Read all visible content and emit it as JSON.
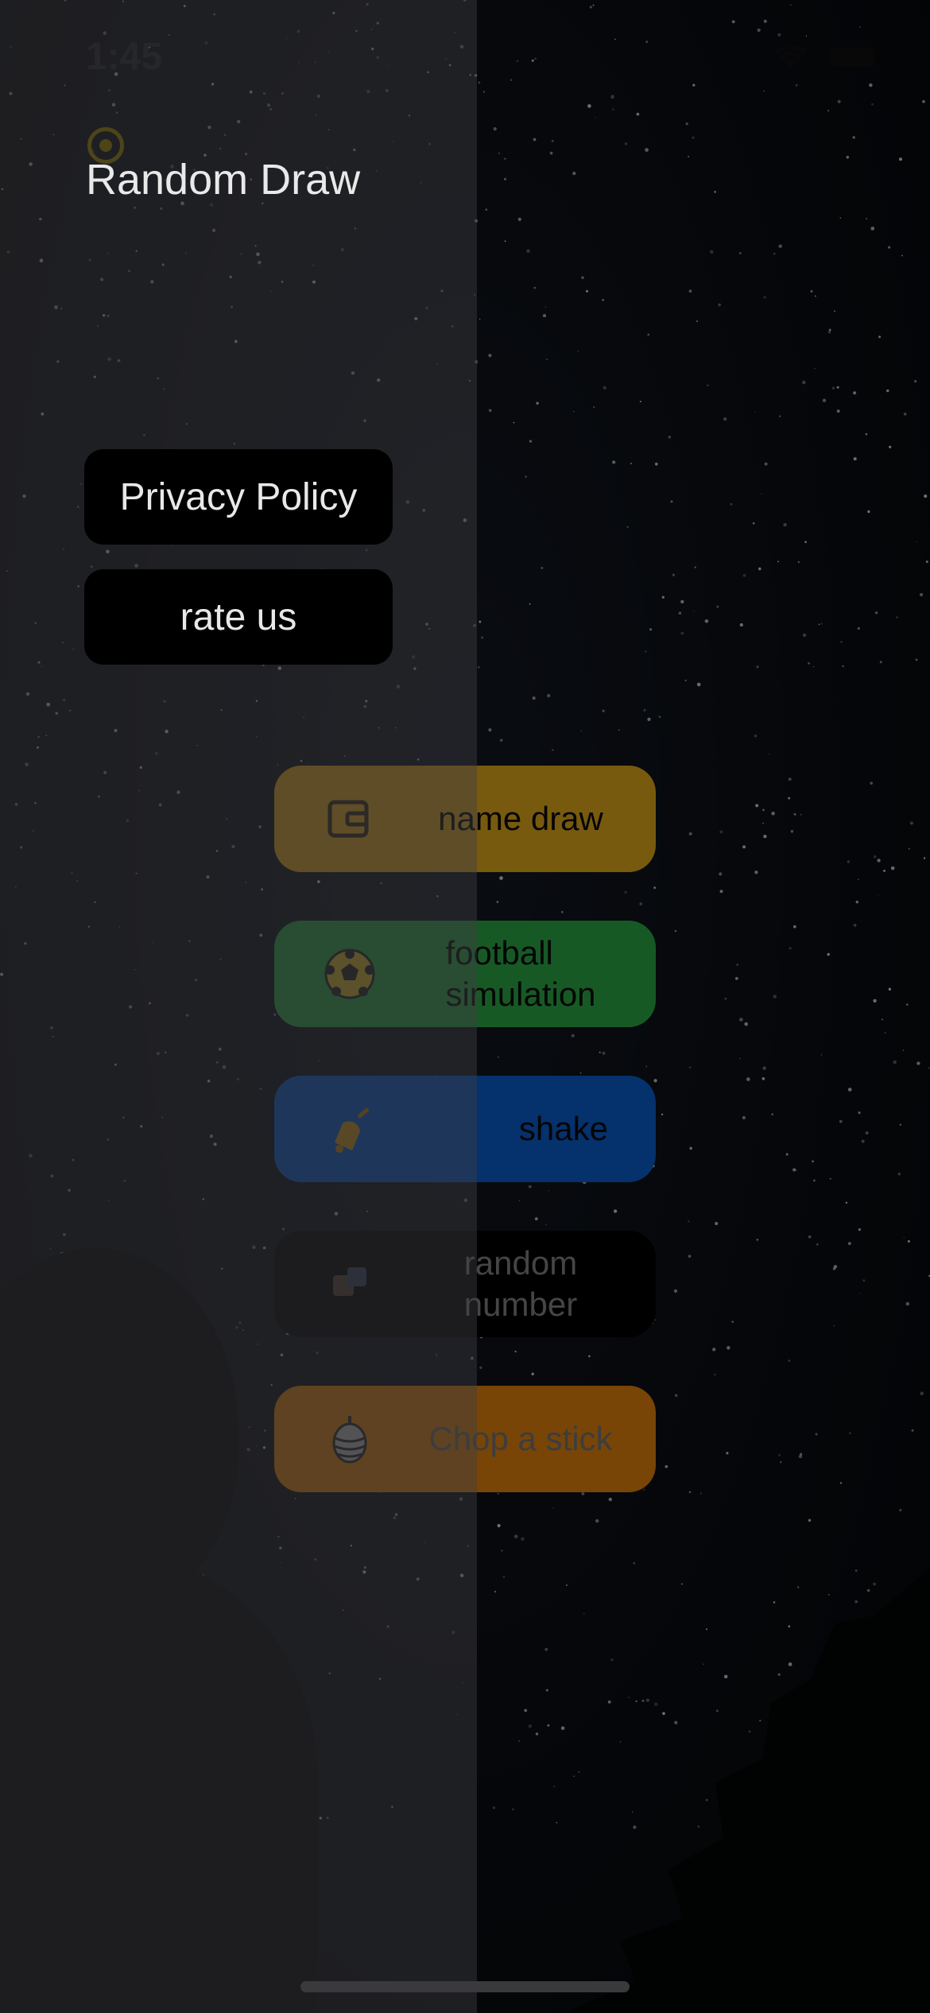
{
  "status_bar": {
    "time": "1:45",
    "wifi_icon": "wifi-icon",
    "battery_icon": "battery-icon"
  },
  "menu": {
    "logo_icon": "target-icon",
    "title": "Random Draw",
    "items": [
      {
        "label": "Privacy Policy"
      },
      {
        "label": "rate us"
      }
    ]
  },
  "modes": [
    {
      "label": "name draw",
      "icon": "wallet-icon",
      "color": "#f1b51f"
    },
    {
      "label": "football\nsimulation",
      "icon": "soccer-ball-icon",
      "color": "#2fb34a"
    },
    {
      "label": "shake",
      "icon": "bell-icon",
      "color": "#0a62d8"
    },
    {
      "label": "random\nnumber",
      "icon": "dice-icon",
      "color": "#000000"
    },
    {
      "label": "Chop a stick",
      "icon": "pinecone-icon",
      "color": "#f08a0c"
    }
  ]
}
